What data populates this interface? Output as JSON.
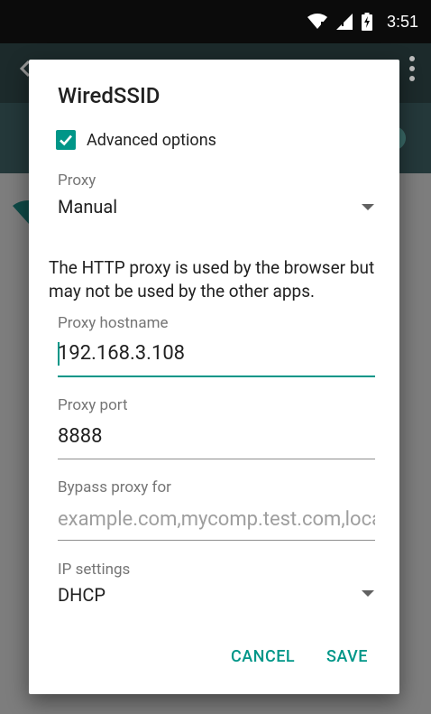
{
  "status_bar": {
    "time": "3:51",
    "icons": [
      "wifi-icon",
      "signal-icon",
      "battery-charging-icon"
    ]
  },
  "dialog": {
    "title": "WiredSSID",
    "advanced_options": {
      "label": "Advanced options",
      "checked": true
    },
    "proxy": {
      "label": "Proxy",
      "value": "Manual"
    },
    "helper_text": "The HTTP proxy is used by the browser but may not be used by the other apps.",
    "proxy_hostname": {
      "label": "Proxy hostname",
      "value": "192.168.3.108"
    },
    "proxy_port": {
      "label": "Proxy port",
      "value": "8888"
    },
    "bypass_proxy": {
      "label": "Bypass proxy for",
      "placeholder": "example.com,mycomp.test.com,localhost"
    },
    "ip_settings": {
      "label": "IP settings",
      "value": "DHCP"
    },
    "buttons": {
      "cancel": "CANCEL",
      "save": "SAVE"
    }
  },
  "colors": {
    "accent": "#009688",
    "status_bar": "#0b0b0b",
    "toolbar": "#1c2a2b"
  }
}
